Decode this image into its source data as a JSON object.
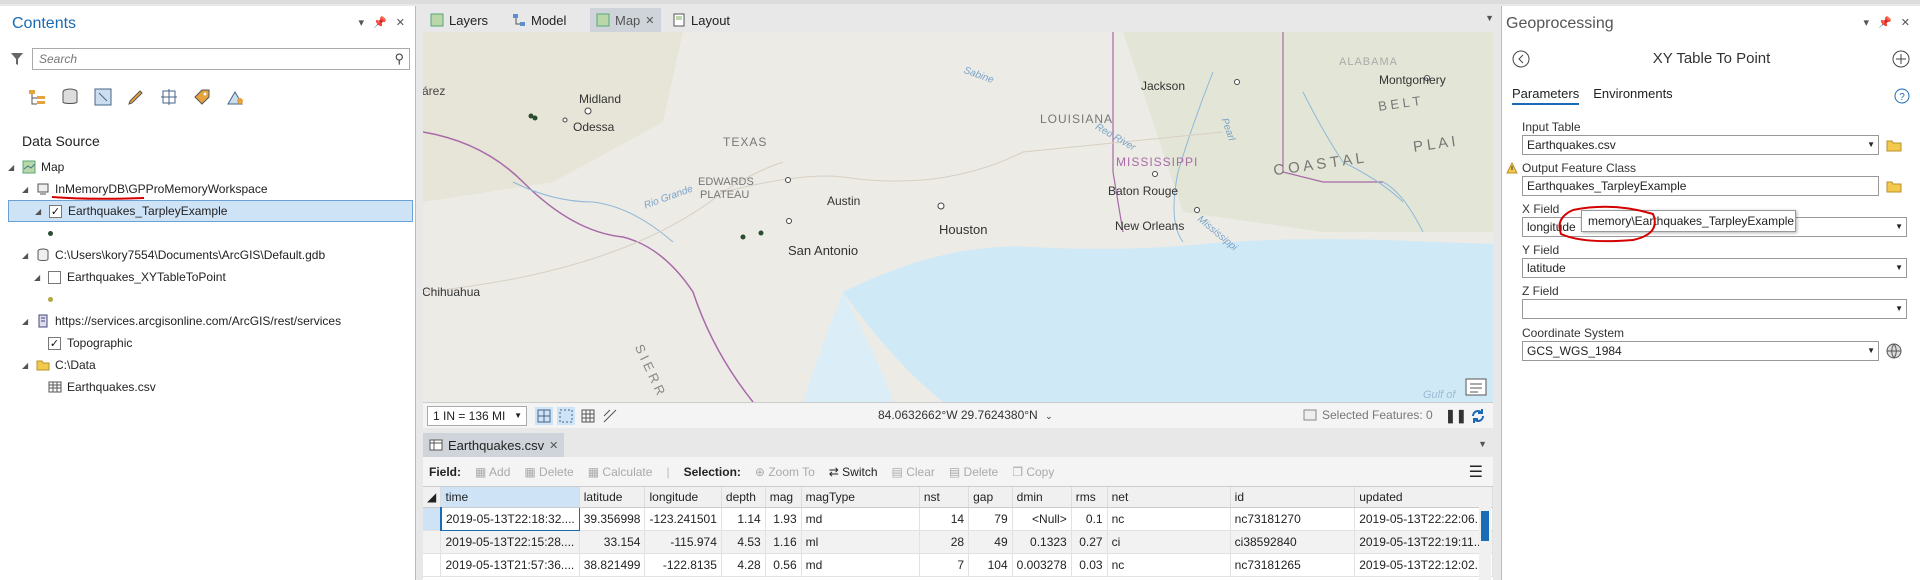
{
  "contents": {
    "title": "Contents",
    "search_placeholder": "Search",
    "section_label": "Data Source",
    "tree": {
      "map": "Map",
      "inmemory": "InMemoryDB\\GPProMemoryWorkspace",
      "layer1": "Earthquakes_TarpleyExample",
      "gdb": "C:\\Users\\kory7554\\Documents\\ArcGIS\\Default.gdb",
      "layer2": "Earthquakes_XYTableToPoint",
      "services": "https://services.arcgisonline.com/ArcGIS/rest/services",
      "topographic": "Topographic",
      "folder": "C:\\Data",
      "csv": "Earthquakes.csv"
    }
  },
  "view_tabs": [
    "Layers",
    "Model",
    "Map",
    "Layout"
  ],
  "map": {
    "labels": {
      "midland": "Midland",
      "odessa": "Odessa",
      "texas": "TEXAS",
      "edwards": "EDWARDS",
      "plateau": "PLATEAU",
      "austin": "Austin",
      "sanantonio": "San Antonio",
      "houston": "Houston",
      "louisiana": "LOUISIANA",
      "mississippi": "MISSISSIPPI",
      "batonrouge": "Baton Rouge",
      "neworleans": "New Orleans",
      "jackson": "Jackson",
      "montgomery": "Montgomery",
      "coastal": "C O A S T A L",
      "plai": "P L A I",
      "belt": "B E L T",
      "alabama": "ALABAMA",
      "chihuahua": "Chihuahua",
      "juarez": "árez",
      "riogrande": "Rio Grande",
      "sabine": "Sabine",
      "redriver": "Red River",
      "mississippiriver": "Mississippi",
      "pearl": "Pearl",
      "sierra": "S I E R R",
      "gulf": "Gulf of"
    },
    "scale": "1 IN = 136 MI",
    "coords": "84.0632662°W 29.7624380°N",
    "selected_features": "Selected Features: 0"
  },
  "table_tab": "Earthquakes.csv",
  "table_toolbar": {
    "field_label": "Field:",
    "add": "Add",
    "delete": "Delete",
    "calculate": "Calculate",
    "selection_label": "Selection:",
    "zoom_to": "Zoom To",
    "switch": "Switch",
    "clear": "Clear",
    "delete2": "Delete",
    "copy": "Copy"
  },
  "table": {
    "columns": [
      "time",
      "latitude",
      "longitude",
      "depth",
      "mag",
      "magType",
      "nst",
      "gap",
      "dmin",
      "rms",
      "net",
      "id",
      "updated"
    ],
    "rows": [
      [
        "2019-05-13T22:18:32....",
        "39.356998",
        "-123.241501",
        "1.14",
        "1.93",
        "md",
        "14",
        "79",
        "<Null>",
        "0.1",
        "nc",
        "nc73181270",
        "2019-05-13T22:22:06...."
      ],
      [
        "2019-05-13T22:15:28....",
        "33.154",
        "-115.974",
        "4.53",
        "1.16",
        "ml",
        "28",
        "49",
        "0.1323",
        "0.27",
        "ci",
        "ci38592840",
        "2019-05-13T22:19:11...."
      ],
      [
        "2019-05-13T21:57:36....",
        "38.821499",
        "-122.8135",
        "4.28",
        "0.56",
        "md",
        "7",
        "104",
        "0.003278",
        "0.03",
        "nc",
        "nc73181265",
        "2019-05-13T22:12:02...."
      ]
    ]
  },
  "geoprocessing": {
    "title": "Geoprocessing",
    "tool": "XY Table To Point",
    "tab_params": "Parameters",
    "tab_env": "Environments",
    "input_table_label": "Input Table",
    "input_table": "Earthquakes.csv",
    "output_label": "Output Feature Class",
    "output": "Earthquakes_TarpleyExample",
    "x_label": "X Field",
    "x_value": "longitude",
    "y_label": "Y Field",
    "y_value": "latitude",
    "z_label": "Z Field",
    "z_value": "",
    "cs_label": "Coordinate System",
    "cs_value": "GCS_WGS_1984",
    "tooltip": "memory\\Earthquakes_TarpleyExample"
  },
  "colors": {
    "accent": "#1a6bb5",
    "annotation_red": "#d40000",
    "selection": "#cfe3f7"
  }
}
